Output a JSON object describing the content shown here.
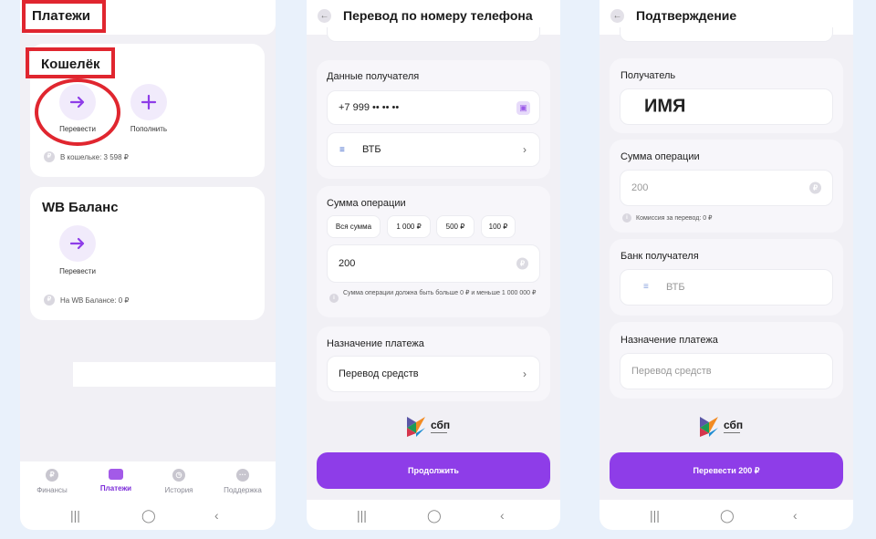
{
  "screen1": {
    "title": "Платежи",
    "wallet": {
      "title": "Кошелёк",
      "transfer_label": "Перевести",
      "topup_label": "Пополнить",
      "balance_text": "В кошельке: 3 598 ₽",
      "coin_symbol": "₽"
    },
    "wb_balance": {
      "title": "WB Баланс",
      "transfer_label": "Перевести",
      "balance_text": "На WB Балансе: 0 ₽"
    },
    "nav": [
      {
        "label": "Финансы",
        "icon": "₽"
      },
      {
        "label": "Платежи",
        "icon": ""
      },
      {
        "label": "История",
        "icon": "◷"
      },
      {
        "label": "Поддержка",
        "icon": "···"
      }
    ]
  },
  "screen2": {
    "title": "Перевод по номеру телефона",
    "recipient_section": "Данные получателя",
    "phone_value": "+7 999 •• •• ••",
    "bank_value": "ВТБ",
    "amount_section": "Сумма операции",
    "chips": [
      "Вся сумма",
      "1 000 ₽",
      "500 ₽",
      "100 ₽"
    ],
    "amount_value": "200",
    "amount_hint": "Сумма операции должна быть больше 0 ₽ и меньше 1 000 000 ₽",
    "purpose_section": "Назначение платежа",
    "purpose_value": "Перевод средств",
    "sbp_word": "сбп",
    "continue_label": "Продолжить"
  },
  "screen3": {
    "title": "Подтверждение",
    "recipient_section": "Получатель",
    "recipient_name": "ИМЯ",
    "amount_section": "Сумма операции",
    "amount_value": "200",
    "commission_text": "Комиссия за перевод: 0 ₽",
    "bank_section": "Банк получателя",
    "bank_value": "ВТБ",
    "purpose_section": "Назначение платежа",
    "purpose_placeholder": "Перевод средств",
    "sbp_word": "сбп",
    "confirm_label": "Перевести 200 ₽"
  },
  "colors": {
    "accent": "#8e3de8",
    "highlight_red": "#e0262f",
    "background": "#e9f1fb"
  }
}
